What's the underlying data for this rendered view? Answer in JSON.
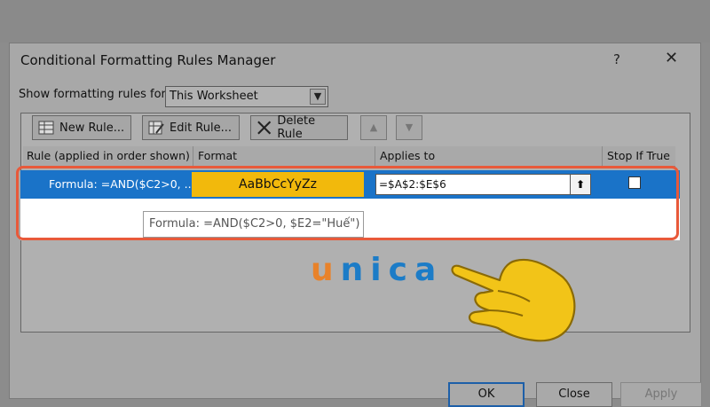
{
  "dialog": {
    "title": "Conditional Formatting Rules Manager",
    "help": "?",
    "close": "✕",
    "show_label": "Show formatting rules for:",
    "show_value": "This Worksheet"
  },
  "toolbar": {
    "new_rule": "New Rule...",
    "edit_rule": "Edit Rule...",
    "delete_rule": "Delete Rule",
    "move_up": "▲",
    "move_down": "▼"
  },
  "columns": [
    "Rule (applied in order shown)",
    "Format",
    "Applies to",
    "Stop If True"
  ],
  "rows": [
    {
      "rule": "Formula: =AND($C2>0, ...",
      "format_preview": "AaBbCcYyZz",
      "applies_to": "=$A$2:$E$6",
      "stop_if_true": false
    }
  ],
  "tooltip": "Formula: =AND($C2>0, $E2=\"Huế\")",
  "buttons": {
    "ok": "OK",
    "close": "Close",
    "apply": "Apply"
  },
  "watermark": {
    "first": "u",
    "rest": "nica"
  },
  "colors": {
    "selection": "#1a73c8",
    "format_fill": "#f2b90c",
    "highlight": "#e8593a",
    "logo_orange": "#e8822a",
    "logo_blue": "#1c7cc7"
  }
}
